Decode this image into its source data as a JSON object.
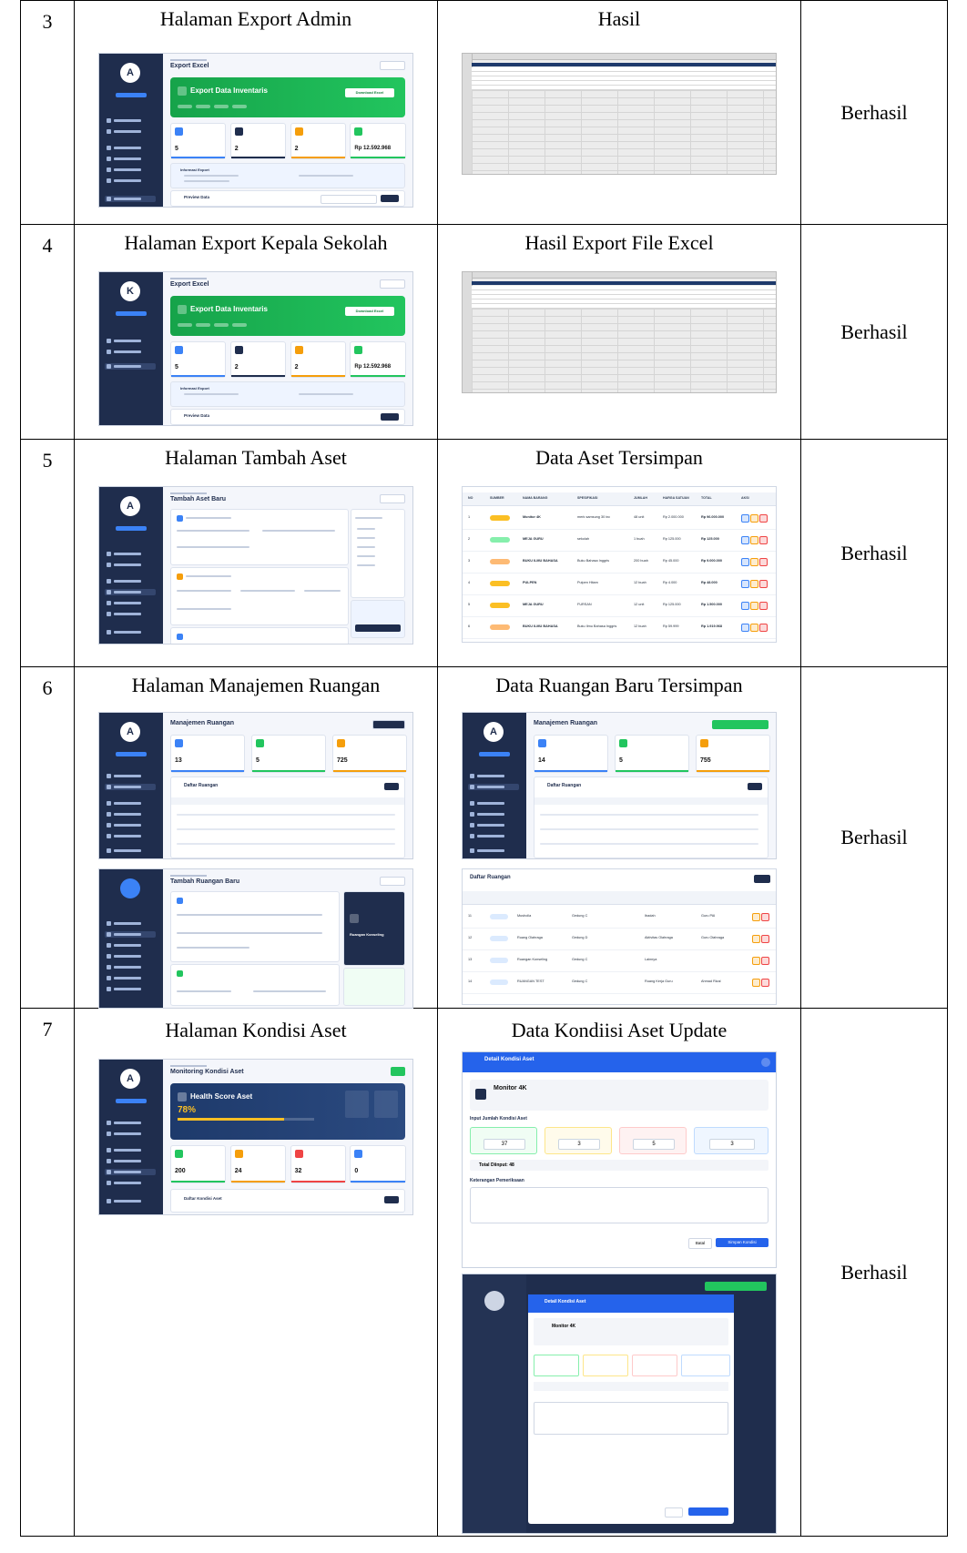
{
  "rows": [
    {
      "no": "3",
      "left_title": "Halaman Export Admin",
      "right_title": "Hasil",
      "result": "Berhasil"
    },
    {
      "no": "4",
      "left_title": "Halaman Export Kepala Sekolah",
      "right_title": "Hasil Export File Excel",
      "result": "Berhasil"
    },
    {
      "no": "5",
      "left_title": "Halaman Tambah Aset",
      "right_title": "Data Aset Tersimpan",
      "result": "Berhasil"
    },
    {
      "no": "6",
      "left_title": "Halaman Manajemen Ruangan",
      "right_title": "Data Ruangan Baru Tersimpan",
      "result": "Berhasil"
    },
    {
      "no": "7",
      "left_title": "Halaman Kondisi Aset",
      "right_title": "Data Kondiisi Aset Update",
      "result": "Berhasil"
    }
  ],
  "shots": {
    "export_title": "Export Excel",
    "export_hero": "Export Data Inventaris",
    "export_download": "Download Excel",
    "export_total": "Rp 12.592.968",
    "export_c1": "5",
    "export_c2": "2",
    "export_c3": "2",
    "export_preview": "Preview Data",
    "export_info": "Informasi Export",
    "avatar_admin": "A",
    "avatar_kepsek": "K",
    "tambah_title": "Tambah Aset Baru",
    "ruangan_title": "Manajemen Ruangan",
    "ruangan_c1": "13",
    "ruangan_c2": "5",
    "ruangan_c3": "725",
    "ruangan_list": "Daftar Ruangan",
    "ruangan_new_title": "Tambah Ruangan Baru",
    "ruangan_saved_c1": "14",
    "ruangan_saved_c3": "755",
    "kondisi_title": "Monitoring Kondisi Aset",
    "kondisi_health": "Health Score Aset",
    "kondisi_pct": "78%",
    "kondisi_c1": "200",
    "kondisi_c2": "24",
    "kondisi_c3": "32",
    "kondisi_c4": "0",
    "kondisi_list": "Daftar Kondisi Aset",
    "modal_title": "Detail Kondisi Aset",
    "modal_asset": "Monitor 4K",
    "modal_section": "Input Jumlah Kondisi Aset",
    "modal_baik": "37",
    "modal_ringan": "3",
    "modal_berat": "5",
    "modal_perbaikan": "3",
    "modal_total": "Total Diinput: 48",
    "modal_note": "Keterangan Pemeriksaan",
    "modal_cancel": "Batal",
    "modal_save": "Simpan Kondisi",
    "aset_cols": [
      "NO",
      "SUMBER",
      "NAMA BARANG",
      "SPESIFIKASI",
      "JUMLAH",
      "HARGA SATUAN",
      "TOTAL",
      "AKSI"
    ],
    "aset_rows": [
      {
        "no": "1",
        "nama": "Monitor 4K",
        "spes": "merk samsung 30 inc",
        "jml": "48 unit",
        "harga": "Rp 2.000.000",
        "total": "Rp 96.000.000",
        "src": "#fbbf24"
      },
      {
        "no": "2",
        "nama": "MEJA GURU",
        "spes": "sekolah",
        "jml": "1 buah",
        "harga": "Rp 125.000",
        "total": "Rp 125.000",
        "src": "#86efac"
      },
      {
        "no": "3",
        "nama": "BUKU ILMU BAHASA",
        "spes": "Buku Bahasa Inggris",
        "jml": "200 buah",
        "harga": "Rp 45.000",
        "total": "Rp 9.000.000",
        "src": "#fdba74"
      },
      {
        "no": "4",
        "nama": "PULPEN",
        "spes": "Pulpen Hitam",
        "jml": "12 buah",
        "harga": "Rp 4.000",
        "total": "Rp 48.000",
        "src": "#fbbf24"
      },
      {
        "no": "5",
        "nama": "MEJA GURU",
        "spes": "FURSAN",
        "jml": "12 unit",
        "harga": "Rp 125.000",
        "total": "Rp 1.500.000",
        "src": "#fbbf24"
      },
      {
        "no": "6",
        "nama": "BUKU ILMU BAHASA",
        "spes": "Buku Ilmu Bahasa Inggris",
        "jml": "12 buah",
        "harga": "Rp 59.999",
        "total": "Rp 1.919.968",
        "src": "#fdba74"
      }
    ],
    "ruang_rows": [
      {
        "no": "11",
        "nama": "Musholla",
        "gedung": "Gedung C",
        "fungsi": "Ibadah",
        "pj": "Guru PAI"
      },
      {
        "no": "12",
        "nama": "Ruang Olahraga",
        "gedung": "Gedung D",
        "fungsi": "Aktivitas Olahraga",
        "pj": "Guru Olahraga"
      },
      {
        "no": "13",
        "nama": "Ruangan Konseling",
        "gedung": "Gedung C",
        "fungsi": "Lainnya",
        "pj": ""
      },
      {
        "no": "14",
        "nama": "RUANGAN TEST",
        "gedung": "Gedung C",
        "fungsi": "Ruang Kerja Guru",
        "pj": "Ahmad Rizal"
      }
    ]
  }
}
